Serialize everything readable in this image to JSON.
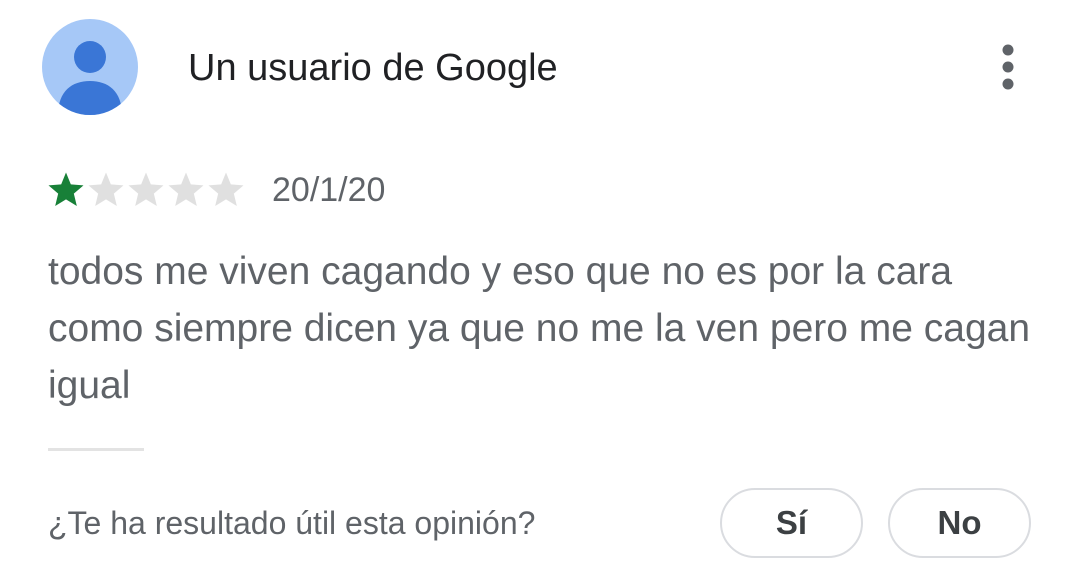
{
  "review": {
    "author": "Un usuario de Google",
    "avatar_icon": "person-icon",
    "menu_icon": "more-vert-icon",
    "rating": 1,
    "rating_max": 5,
    "date": "20/1/20",
    "text": "todos me viven cagando y eso que no es por la cara como siempre dicen ya que no me la ven pero me cagan igual"
  },
  "helpful": {
    "question": "¿Te ha resultado útil esta opinión?",
    "yes_label": "Sí",
    "no_label": "No"
  },
  "colors": {
    "star_filled": "#188038",
    "star_empty": "#e0e0e0",
    "avatar_bg": "#a6c8f7",
    "avatar_fg": "#3a76d6"
  }
}
